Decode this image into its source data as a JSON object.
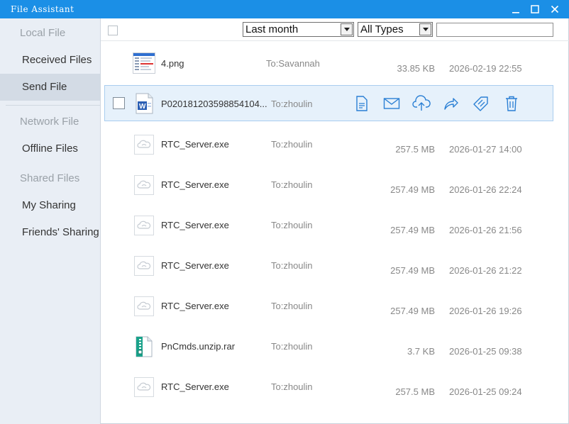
{
  "window": {
    "title": "File Assistant"
  },
  "sidebar": {
    "items": [
      {
        "label": "Local File",
        "type": "header"
      },
      {
        "label": "Received Files",
        "type": "item"
      },
      {
        "label": "Send File",
        "type": "item",
        "active": true
      },
      {
        "label": "Network File",
        "type": "header"
      },
      {
        "label": "Offline Files",
        "type": "item"
      },
      {
        "label": "Shared Files",
        "type": "header"
      },
      {
        "label": "My Sharing",
        "type": "item"
      },
      {
        "label": "Friends' Sharing",
        "type": "item"
      }
    ]
  },
  "toolbar": {
    "time_filter": "Last month",
    "type_filter": "All Types",
    "search_value": ""
  },
  "files": [
    {
      "name": "4.png",
      "to": "To:Savannah",
      "size": "33.85 KB",
      "date": "2026-02-19 22:55",
      "icon": "image-file-icon"
    },
    {
      "name": "P020181203598854104...",
      "to": "To:zhoulin",
      "size": "",
      "date": "",
      "icon": "word-document-icon",
      "selected": true
    },
    {
      "name": "RTC_Server.exe",
      "to": "To:zhoulin",
      "size": "257.5 MB",
      "date": "2026-01-27 14:00",
      "icon": "exe-file-icon"
    },
    {
      "name": "RTC_Server.exe",
      "to": "To:zhoulin",
      "size": "257.49 MB",
      "date": "2026-01-26 22:24",
      "icon": "exe-file-icon"
    },
    {
      "name": "RTC_Server.exe",
      "to": "To:zhoulin",
      "size": "257.49 MB",
      "date": "2026-01-26 21:56",
      "icon": "exe-file-icon"
    },
    {
      "name": "RTC_Server.exe",
      "to": "To:zhoulin",
      "size": "257.49 MB",
      "date": "2026-01-26 21:22",
      "icon": "exe-file-icon"
    },
    {
      "name": "RTC_Server.exe",
      "to": "To:zhoulin",
      "size": "257.49 MB",
      "date": "2026-01-26 19:26",
      "icon": "exe-file-icon"
    },
    {
      "name": "PnCmds.unzip.rar",
      "to": "To:zhoulin",
      "size": "3.7 KB",
      "date": "2026-01-25 09:38",
      "icon": "archive-file-icon"
    },
    {
      "name": "RTC_Server.exe",
      "to": "To:zhoulin",
      "size": "257.5 MB",
      "date": "2026-01-25 09:24",
      "icon": "exe-file-icon"
    }
  ],
  "row_actions": [
    "open-document-icon",
    "email-icon",
    "upload-cloud-icon",
    "forward-icon",
    "tag-icon",
    "delete-icon"
  ],
  "colors": {
    "titlebar": "#1b8fe6",
    "accent_icon": "#2a7fd4",
    "selected_row": "#e6f1fb"
  }
}
